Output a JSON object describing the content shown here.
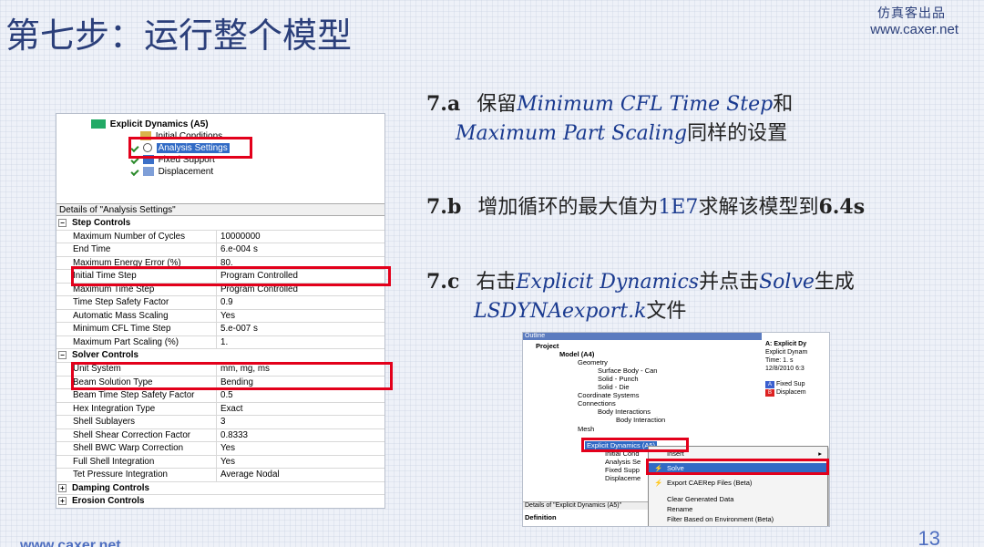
{
  "slide": {
    "title": "第七步：运行整个模型",
    "brand_cn": "仿真客出品",
    "brand_url": "www.caxer.net",
    "footer_url": "www.caxer.net",
    "page_number": "13"
  },
  "steps": [
    {
      "num": "7.a",
      "text1": "保留",
      "em1": "Minimum CFL Time Step",
      "text2": "和",
      "em2": "Maximum Part Scaling",
      "text3": "同样的设置"
    },
    {
      "num": "7.b",
      "text1": "增加循环的最大值为",
      "value": "1E7",
      "text2": "求解该模型到",
      "strong": "6.4s"
    },
    {
      "num": "7.c",
      "text1": "右击",
      "em1": "Explicit Dynamics",
      "text2": "并点击",
      "em2": "Solve",
      "text3": "生成",
      "em3": "LSDYNAexport.k",
      "text4": "文件"
    }
  ],
  "left_tree": {
    "parent_label": "Explicit Dynamics (A5)",
    "items": [
      "Initial Conditions",
      "Analysis Settings",
      "Fixed Support",
      "Displacement"
    ]
  },
  "details": {
    "header": "Details of \"Analysis Settings\"",
    "groups": [
      {
        "name": "Step Controls",
        "rows": [
          {
            "k": "Maximum Number of Cycles",
            "v": "10000000"
          },
          {
            "k": "End Time",
            "v": "6.e-004 s"
          },
          {
            "k": "Maximum Energy Error (%)",
            "v": "80."
          },
          {
            "k": "Initial Time Step",
            "v": "Program Controlled"
          },
          {
            "k": "Maximum Time Step",
            "v": "Program Controlled"
          },
          {
            "k": "Time Step Safety Factor",
            "v": "0.9"
          },
          {
            "k": "Automatic Mass Scaling",
            "v": "Yes"
          },
          {
            "k": "Minimum CFL Time Step",
            "v": "5.e-007 s"
          },
          {
            "k": "Maximum Part Scaling (%)",
            "v": "1."
          }
        ]
      },
      {
        "name": "Solver Controls",
        "rows": [
          {
            "k": "Unit System",
            "v": "mm, mg, ms"
          },
          {
            "k": "Beam Solution Type",
            "v": "Bending"
          },
          {
            "k": "Beam Time Step Safety Factor",
            "v": "0.5"
          },
          {
            "k": "Hex Integration Type",
            "v": "Exact"
          },
          {
            "k": "Shell Sublayers",
            "v": "3"
          },
          {
            "k": "Shell Shear Correction Factor",
            "v": "0.8333"
          },
          {
            "k": "Shell BWC Warp Correction",
            "v": "Yes"
          },
          {
            "k": "Full Shell Integration",
            "v": "Yes"
          },
          {
            "k": "Tet Pressure Integration",
            "v": "Average Nodal"
          }
        ]
      },
      {
        "name": "Damping Controls",
        "rows": []
      },
      {
        "name": "Erosion Controls",
        "rows": []
      }
    ]
  },
  "right_ss": {
    "outline_label": "Outline",
    "tree": [
      "Project",
      "Model (A4)",
      "Geometry",
      "Surface Body - Can",
      "Solid - Punch",
      "Solid - Die",
      "Coordinate Systems",
      "Connections",
      "Body Interactions",
      "Body Interaction",
      "Mesh",
      "Explicit Dynamics (A5)",
      "Initial Cond",
      "Analysis Se",
      "Fixed Supp",
      "Displaceme"
    ],
    "side_panel": [
      "A: Explicit Dy",
      "Explicit Dynam",
      "Time: 1. s",
      "12/8/2010 6:3",
      "Fixed Sup",
      "Displacem"
    ],
    "side_badges": [
      "A",
      "B"
    ],
    "context_menu": [
      "Insert",
      "Solve",
      "Export CAERep Files (Beta)",
      "Clear Generated Data",
      "Rename",
      "Filter Based on Environment (Beta)"
    ],
    "details_label": "Details of \"Explicit Dynamics (A5)\"",
    "definition_label": "Definition"
  }
}
